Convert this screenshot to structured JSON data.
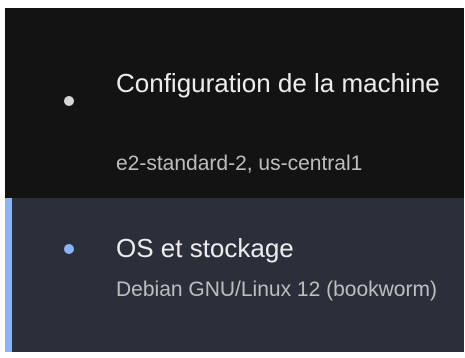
{
  "colors": {
    "panel_background": "#131313",
    "active_background": "#2b2f3a",
    "accent": "#8ab4f8",
    "inactive_dot": "#d6d6d6",
    "title_text": "#ececec",
    "subtitle_text": "#bdbdbd"
  },
  "steps": [
    {
      "title": "Configuration de la machine",
      "subtitle": "e2-standard-2, us-central1",
      "active": false,
      "icon": "bullet-dot-icon"
    },
    {
      "title": "OS et stockage",
      "subtitle": "Debian GNU/Linux 12 (bookworm)",
      "active": true,
      "icon": "bullet-dot-icon"
    }
  ]
}
